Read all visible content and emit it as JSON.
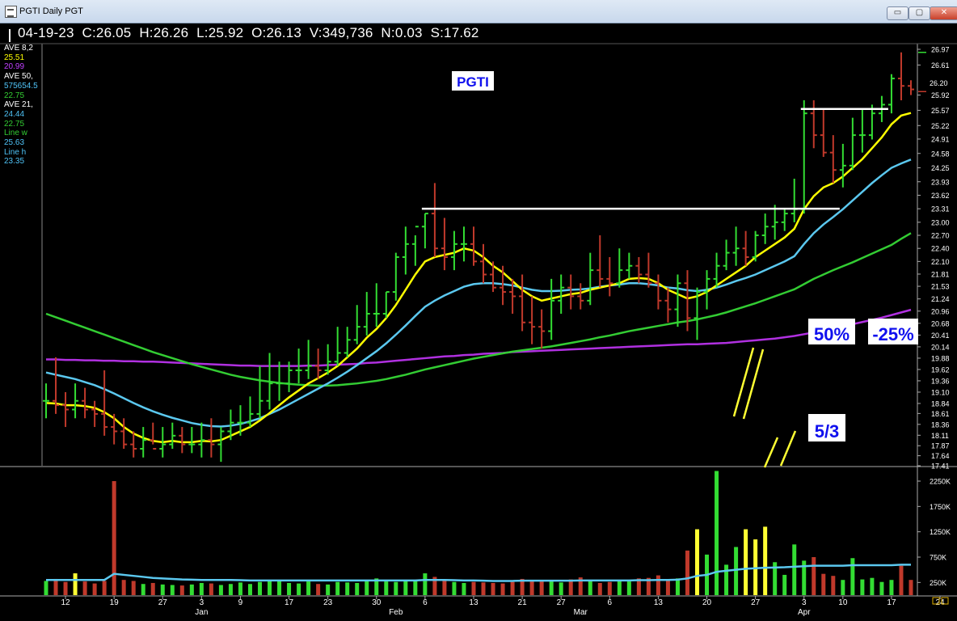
{
  "window": {
    "title": "PGTI Daily PGT",
    "buttons": {
      "minimize": "▭",
      "maximize": "▢",
      "close": "✕"
    }
  },
  "header": {
    "date": "04-19-23",
    "close": "C:26.05",
    "high": "H:26.26",
    "low": "L:25.92",
    "open": "O:26.13",
    "volume": "V:349,736",
    "net": "N:0.03",
    "s": "S:17.62"
  },
  "legend": [
    {
      "text": "AVE 8,2",
      "color": "#ffffff"
    },
    {
      "text": "25.51",
      "color": "#ffff00"
    },
    {
      "text": "20.99",
      "color": "#c040ff"
    },
    {
      "text": "AVE 50,",
      "color": "#ffffff"
    },
    {
      "text": "575654.5",
      "color": "#4fc3f7"
    },
    {
      "text": "22.75",
      "color": "#33cc33"
    },
    {
      "text": "AVE 21,",
      "color": "#ffffff"
    },
    {
      "text": "24.44",
      "color": "#4fc3f7"
    },
    {
      "text": "22.75",
      "color": "#33cc33"
    },
    {
      "text": "Line    w",
      "color": "#33cc33"
    },
    {
      "text": "25.63",
      "color": "#4fc3f7"
    },
    {
      "text": "Line    h",
      "color": "#4fc3f7"
    },
    {
      "text": "23.35",
      "color": "#4fc3f7"
    }
  ],
  "annotations": {
    "ticker_label": "PGTI",
    "pct_up": "50%",
    "pct_down": "-25%",
    "date_note": "5/3"
  },
  "colors": {
    "up": "#33dd33",
    "down": "#c0392b",
    "ma_fast": "#ffff00",
    "ma_mid": "#5bc8ef",
    "ma_slow": "#33cc33",
    "ma_long": "#b030e0",
    "annotation_text": "#1010ee",
    "background": "#000000"
  },
  "price_axis": {
    "ticks": [
      "26.97",
      "26.61",
      "25.92",
      "25.57",
      "25.22",
      "24.91",
      "24.58",
      "24.25",
      "23.93",
      "23.62",
      "23.31",
      "23.00",
      "22.70",
      "22.40",
      "22.10",
      "21.81",
      "21.53",
      "21.24",
      "20.96",
      "20.68",
      "20.41",
      "20.14",
      "19.88",
      "19.62",
      "19.36",
      "19.10",
      "18.84",
      "18.61",
      "18.36",
      "18.11",
      "17.87",
      "17.64",
      "17.41"
    ],
    "current": "26.20"
  },
  "volume_axis": {
    "ticks": [
      "2250K",
      "1750K",
      "1250K",
      "750K",
      "250K"
    ]
  },
  "x_axis": {
    "day_ticks": [
      "12",
      "19",
      "27",
      "3",
      "9",
      "17",
      "23",
      "30",
      "6",
      "13",
      "21",
      "27",
      "6",
      "13",
      "20",
      "27",
      "3",
      "10",
      "17",
      "24"
    ],
    "month_labels": [
      "Jan",
      "Feb",
      "Mar",
      "Apr"
    ]
  },
  "chart_data": {
    "type": "ohlc",
    "title": "PGTI Daily PGT",
    "ylim": [
      17.41,
      26.97
    ],
    "x": [
      "2022-12-08",
      "2022-12-09",
      "2022-12-12",
      "2022-12-13",
      "2022-12-14",
      "2022-12-15",
      "2022-12-16",
      "2022-12-19",
      "2022-12-20",
      "2022-12-21",
      "2022-12-22",
      "2022-12-23",
      "2022-12-27",
      "2022-12-28",
      "2022-12-29",
      "2022-12-30",
      "2023-01-03",
      "2023-01-04",
      "2023-01-05",
      "2023-01-06",
      "2023-01-09",
      "2023-01-10",
      "2023-01-11",
      "2023-01-12",
      "2023-01-13",
      "2023-01-17",
      "2023-01-18",
      "2023-01-19",
      "2023-01-20",
      "2023-01-23",
      "2023-01-24",
      "2023-01-25",
      "2023-01-26",
      "2023-01-27",
      "2023-01-30",
      "2023-01-31",
      "2023-02-01",
      "2023-02-02",
      "2023-02-03",
      "2023-02-06",
      "2023-02-07",
      "2023-02-08",
      "2023-02-09",
      "2023-02-10",
      "2023-02-13",
      "2023-02-14",
      "2023-02-15",
      "2023-02-16",
      "2023-02-17",
      "2023-02-21",
      "2023-02-22",
      "2023-02-23",
      "2023-02-24",
      "2023-02-27",
      "2023-02-28",
      "2023-03-01",
      "2023-03-02",
      "2023-03-03",
      "2023-03-06",
      "2023-03-07",
      "2023-03-08",
      "2023-03-09",
      "2023-03-10",
      "2023-03-13",
      "2023-03-14",
      "2023-03-15",
      "2023-03-16",
      "2023-03-17",
      "2023-03-20",
      "2023-03-21",
      "2023-03-22",
      "2023-03-23",
      "2023-03-24",
      "2023-03-27",
      "2023-03-28",
      "2023-03-29",
      "2023-03-30",
      "2023-03-31",
      "2023-04-03",
      "2023-04-04",
      "2023-04-05",
      "2023-04-06",
      "2023-04-10",
      "2023-04-11",
      "2023-04-12",
      "2023-04-13",
      "2023-04-14",
      "2023-04-17",
      "2023-04-18",
      "2023-04-19"
    ],
    "open": [
      18.9,
      18.9,
      18.8,
      18.7,
      18.9,
      18.7,
      18.6,
      18.3,
      18.2,
      17.9,
      17.8,
      18.0,
      17.8,
      17.9,
      18.1,
      17.9,
      17.9,
      18.0,
      17.9,
      18.2,
      18.4,
      18.4,
      18.6,
      18.9,
      19.3,
      19.3,
      19.6,
      19.6,
      19.7,
      19.6,
      19.8,
      20.0,
      20.3,
      20.6,
      20.9,
      20.9,
      21.4,
      22.2,
      22.5,
      22.9,
      23.2,
      22.4,
      22.2,
      22.5,
      22.5,
      22.1,
      21.8,
      21.5,
      21.4,
      21.3,
      20.7,
      20.6,
      20.5,
      21.2,
      21.5,
      21.3,
      21.2,
      21.9,
      21.7,
      21.6,
      21.9,
      22.0,
      21.8,
      21.6,
      21.2,
      21.0,
      21.6,
      20.8,
      21.4,
      21.7,
      22.0,
      22.3,
      22.4,
      22.2,
      22.7,
      22.9,
      23.0,
      23.2,
      23.3,
      25.5,
      25.0,
      24.6,
      24.2,
      24.3,
      25.0,
      25.0,
      25.5,
      25.7,
      26.3,
      26.13
    ],
    "high": [
      19.3,
      19.9,
      19.1,
      19.3,
      19.2,
      18.9,
      19.6,
      18.6,
      18.5,
      18.2,
      18.3,
      18.4,
      18.3,
      18.4,
      18.3,
      18.3,
      18.4,
      18.5,
      18.3,
      18.7,
      18.8,
      19.0,
      19.7,
      20.0,
      19.8,
      19.8,
      20.1,
      20.3,
      20.1,
      20.2,
      20.6,
      20.6,
      21.1,
      21.4,
      21.6,
      21.4,
      22.3,
      22.9,
      22.7,
      23.2,
      23.9,
      23.1,
      22.8,
      22.9,
      22.9,
      22.5,
      22.1,
      22.0,
      21.7,
      21.8,
      21.3,
      21.0,
      21.7,
      21.8,
      21.8,
      21.6,
      22.3,
      22.7,
      22.2,
      22.4,
      22.3,
      22.2,
      22.3,
      21.8,
      21.5,
      21.8,
      21.9,
      21.5,
      21.9,
      22.3,
      22.6,
      22.9,
      22.8,
      22.8,
      23.2,
      23.4,
      23.3,
      24.0,
      25.8,
      25.8,
      25.6,
      25.0,
      24.8,
      25.4,
      25.6,
      25.7,
      25.9,
      26.4,
      26.9,
      26.26
    ],
    "low": [
      18.5,
      18.6,
      18.3,
      18.5,
      18.5,
      18.3,
      18.1,
      17.9,
      17.8,
      17.6,
      17.6,
      17.9,
      17.6,
      17.8,
      17.7,
      17.7,
      17.6,
      17.6,
      17.5,
      18.0,
      18.1,
      18.3,
      18.5,
      18.7,
      18.9,
      19.1,
      19.3,
      19.4,
      19.4,
      19.5,
      19.7,
      19.9,
      20.2,
      20.4,
      20.6,
      20.8,
      21.2,
      21.8,
      22.0,
      22.4,
      22.2,
      21.9,
      21.9,
      22.1,
      22.0,
      21.6,
      21.4,
      21.1,
      20.9,
      20.5,
      20.2,
      20.1,
      20.3,
      20.9,
      21.0,
      21.0,
      21.1,
      21.5,
      21.3,
      21.5,
      21.7,
      21.6,
      21.5,
      21.0,
      20.7,
      20.6,
      20.5,
      20.3,
      21.0,
      21.5,
      21.9,
      22.0,
      22.0,
      22.1,
      22.5,
      22.6,
      22.8,
      23.0,
      23.2,
      24.7,
      24.5,
      23.9,
      23.8,
      24.2,
      24.6,
      24.9,
      25.3,
      25.5,
      25.8,
      25.92
    ],
    "close": [
      18.9,
      18.8,
      18.7,
      18.9,
      18.7,
      18.6,
      18.3,
      18.2,
      17.9,
      17.8,
      18.0,
      17.8,
      17.9,
      18.1,
      17.9,
      17.9,
      18.0,
      17.9,
      18.2,
      18.4,
      18.4,
      18.6,
      18.9,
      19.3,
      19.3,
      19.6,
      19.6,
      19.7,
      19.6,
      19.8,
      20.0,
      20.3,
      20.6,
      20.9,
      20.9,
      21.4,
      22.2,
      22.5,
      22.9,
      23.2,
      22.4,
      22.2,
      22.5,
      22.5,
      22.1,
      21.8,
      21.5,
      21.4,
      21.3,
      20.7,
      20.6,
      20.5,
      21.2,
      21.5,
      21.3,
      21.2,
      21.9,
      21.7,
      21.6,
      21.9,
      22.0,
      21.8,
      21.6,
      21.2,
      21.0,
      21.6,
      20.8,
      21.4,
      21.7,
      22.0,
      22.3,
      22.4,
      22.2,
      22.7,
      22.9,
      23.0,
      23.2,
      23.3,
      25.5,
      25.0,
      24.6,
      24.2,
      24.3,
      25.0,
      25.0,
      25.5,
      25.7,
      26.3,
      26.13,
      26.05
    ],
    "volume_k": [
      280,
      320,
      260,
      430,
      270,
      230,
      280,
      2250,
      300,
      280,
      220,
      240,
      210,
      200,
      190,
      210,
      240,
      230,
      200,
      220,
      250,
      220,
      260,
      280,
      300,
      240,
      230,
      270,
      220,
      210,
      260,
      250,
      240,
      300,
      330,
      270,
      260,
      300,
      280,
      430,
      360,
      290,
      260,
      240,
      260,
      250,
      240,
      230,
      260,
      320,
      290,
      270,
      300,
      250,
      310,
      350,
      280,
      240,
      260,
      300,
      270,
      330,
      340,
      390,
      300,
      330,
      880,
      1300,
      800,
      2450,
      600,
      950,
      1300,
      1100,
      1350,
      650,
      400,
      1000,
      680,
      750,
      420,
      380,
      300,
      730,
      310,
      340,
      260,
      300,
      580,
      300
    ],
    "series": [
      {
        "name": "AVE 8",
        "color": "#ffff00",
        "values": [
          18.85,
          18.84,
          18.8,
          18.8,
          18.78,
          18.74,
          18.64,
          18.5,
          18.3,
          18.15,
          18.05,
          17.98,
          17.95,
          17.98,
          17.95,
          17.95,
          17.98,
          17.97,
          18.0,
          18.1,
          18.2,
          18.3,
          18.45,
          18.62,
          18.8,
          18.98,
          19.14,
          19.3,
          19.42,
          19.55,
          19.7,
          19.9,
          20.1,
          20.35,
          20.55,
          20.8,
          21.1,
          21.45,
          21.8,
          22.1,
          22.2,
          22.25,
          22.3,
          22.4,
          22.35,
          22.2,
          22.0,
          21.85,
          21.65,
          21.45,
          21.3,
          21.2,
          21.25,
          21.3,
          21.35,
          21.38,
          21.45,
          21.5,
          21.55,
          21.6,
          21.7,
          21.72,
          21.7,
          21.6,
          21.45,
          21.35,
          21.25,
          21.3,
          21.4,
          21.55,
          21.7,
          21.85,
          22.0,
          22.2,
          22.35,
          22.5,
          22.65,
          22.85,
          23.3,
          23.6,
          23.8,
          23.9,
          24.05,
          24.25,
          24.45,
          24.7,
          24.95,
          25.25,
          25.45,
          25.51
        ]
      },
      {
        "name": "AVE 21",
        "color": "#5bc8ef",
        "values": [
          19.55,
          19.5,
          19.45,
          19.4,
          19.33,
          19.26,
          19.17,
          19.07,
          18.96,
          18.85,
          18.75,
          18.66,
          18.58,
          18.51,
          18.45,
          18.39,
          18.35,
          18.32,
          18.31,
          18.33,
          18.37,
          18.43,
          18.5,
          18.6,
          18.7,
          18.82,
          18.94,
          19.06,
          19.18,
          19.3,
          19.43,
          19.57,
          19.72,
          19.88,
          20.04,
          20.22,
          20.42,
          20.63,
          20.85,
          21.06,
          21.2,
          21.32,
          21.42,
          21.52,
          21.58,
          21.6,
          21.6,
          21.58,
          21.55,
          21.5,
          21.45,
          21.42,
          21.42,
          21.43,
          21.45,
          21.46,
          21.48,
          21.52,
          21.55,
          21.57,
          21.6,
          21.6,
          21.58,
          21.55,
          21.5,
          21.48,
          21.44,
          21.42,
          21.45,
          21.5,
          21.57,
          21.65,
          21.72,
          21.8,
          21.9,
          22.0,
          22.1,
          22.22,
          22.5,
          22.75,
          22.95,
          23.12,
          23.3,
          23.5,
          23.7,
          23.9,
          24.08,
          24.25,
          24.35,
          24.44
        ]
      },
      {
        "name": "AVE 50",
        "color": "#33cc33",
        "values": [
          20.9,
          20.82,
          20.74,
          20.66,
          20.58,
          20.5,
          20.42,
          20.34,
          20.26,
          20.18,
          20.1,
          20.02,
          19.95,
          19.88,
          19.81,
          19.74,
          19.68,
          19.62,
          19.56,
          19.5,
          19.45,
          19.41,
          19.37,
          19.34,
          19.31,
          19.29,
          19.27,
          19.26,
          19.25,
          19.25,
          19.26,
          19.28,
          19.3,
          19.33,
          19.36,
          19.4,
          19.45,
          19.5,
          19.56,
          19.62,
          19.67,
          19.72,
          19.77,
          19.82,
          19.87,
          19.91,
          19.95,
          19.99,
          20.03,
          20.06,
          20.09,
          20.12,
          20.15,
          20.19,
          20.23,
          20.27,
          20.31,
          20.36,
          20.4,
          20.45,
          20.5,
          20.54,
          20.58,
          20.62,
          20.66,
          20.7,
          20.73,
          20.77,
          20.82,
          20.87,
          20.93,
          21.0,
          21.07,
          21.14,
          21.22,
          21.3,
          21.38,
          21.46,
          21.58,
          21.7,
          21.8,
          21.9,
          21.99,
          22.08,
          22.18,
          22.28,
          22.38,
          22.48,
          22.62,
          22.75
        ]
      },
      {
        "name": "AVE 200",
        "color": "#b030e0",
        "values": [
          19.85,
          19.85,
          19.84,
          19.84,
          19.83,
          19.83,
          19.82,
          19.82,
          19.81,
          19.81,
          19.8,
          19.8,
          19.79,
          19.78,
          19.77,
          19.76,
          19.75,
          19.74,
          19.73,
          19.72,
          19.71,
          19.71,
          19.7,
          19.7,
          19.7,
          19.7,
          19.7,
          19.71,
          19.71,
          19.72,
          19.73,
          19.74,
          19.75,
          19.77,
          19.78,
          19.8,
          19.82,
          19.84,
          19.86,
          19.88,
          19.9,
          19.92,
          19.93,
          19.95,
          19.96,
          19.98,
          19.99,
          20.0,
          20.02,
          20.03,
          20.04,
          20.05,
          20.06,
          20.07,
          20.08,
          20.09,
          20.1,
          20.11,
          20.12,
          20.13,
          20.14,
          20.15,
          20.16,
          20.17,
          20.18,
          20.19,
          20.2,
          20.2,
          20.21,
          20.22,
          20.23,
          20.25,
          20.27,
          20.29,
          20.31,
          20.33,
          20.36,
          20.39,
          20.43,
          20.47,
          20.52,
          20.56,
          20.61,
          20.66,
          20.71,
          20.76,
          20.81,
          20.87,
          20.93,
          20.99
        ]
      },
      {
        "name": "Volume average",
        "color": "#5bc8ef",
        "values": [
          300,
          300,
          300,
          300,
          300,
          300,
          300,
          420,
          400,
          380,
          360,
          340,
          330,
          320,
          310,
          305,
          300,
          300,
          300,
          300,
          295,
          290,
          290,
          290,
          290,
          290,
          290,
          290,
          290,
          290,
          290,
          290,
          290,
          290,
          290,
          290,
          290,
          290,
          290,
          300,
          300,
          300,
          295,
          290,
          290,
          285,
          280,
          280,
          280,
          285,
          285,
          285,
          285,
          285,
          285,
          290,
          290,
          290,
          290,
          290,
          290,
          295,
          295,
          300,
          300,
          305,
          330,
          380,
          400,
          460,
          480,
          500,
          520,
          530,
          540,
          545,
          550,
          560,
          570,
          580,
          580,
          580,
          580,
          590,
          590,
          590,
          590,
          590,
          600,
          600
        ]
      }
    ],
    "resistance_lines": [
      {
        "y": 23.31,
        "x_start": "2023-02-06",
        "x_end": "2023-04-06"
      },
      {
        "y": 25.6,
        "x_start": "2023-04-03",
        "x_end": "2023-04-14"
      }
    ]
  }
}
